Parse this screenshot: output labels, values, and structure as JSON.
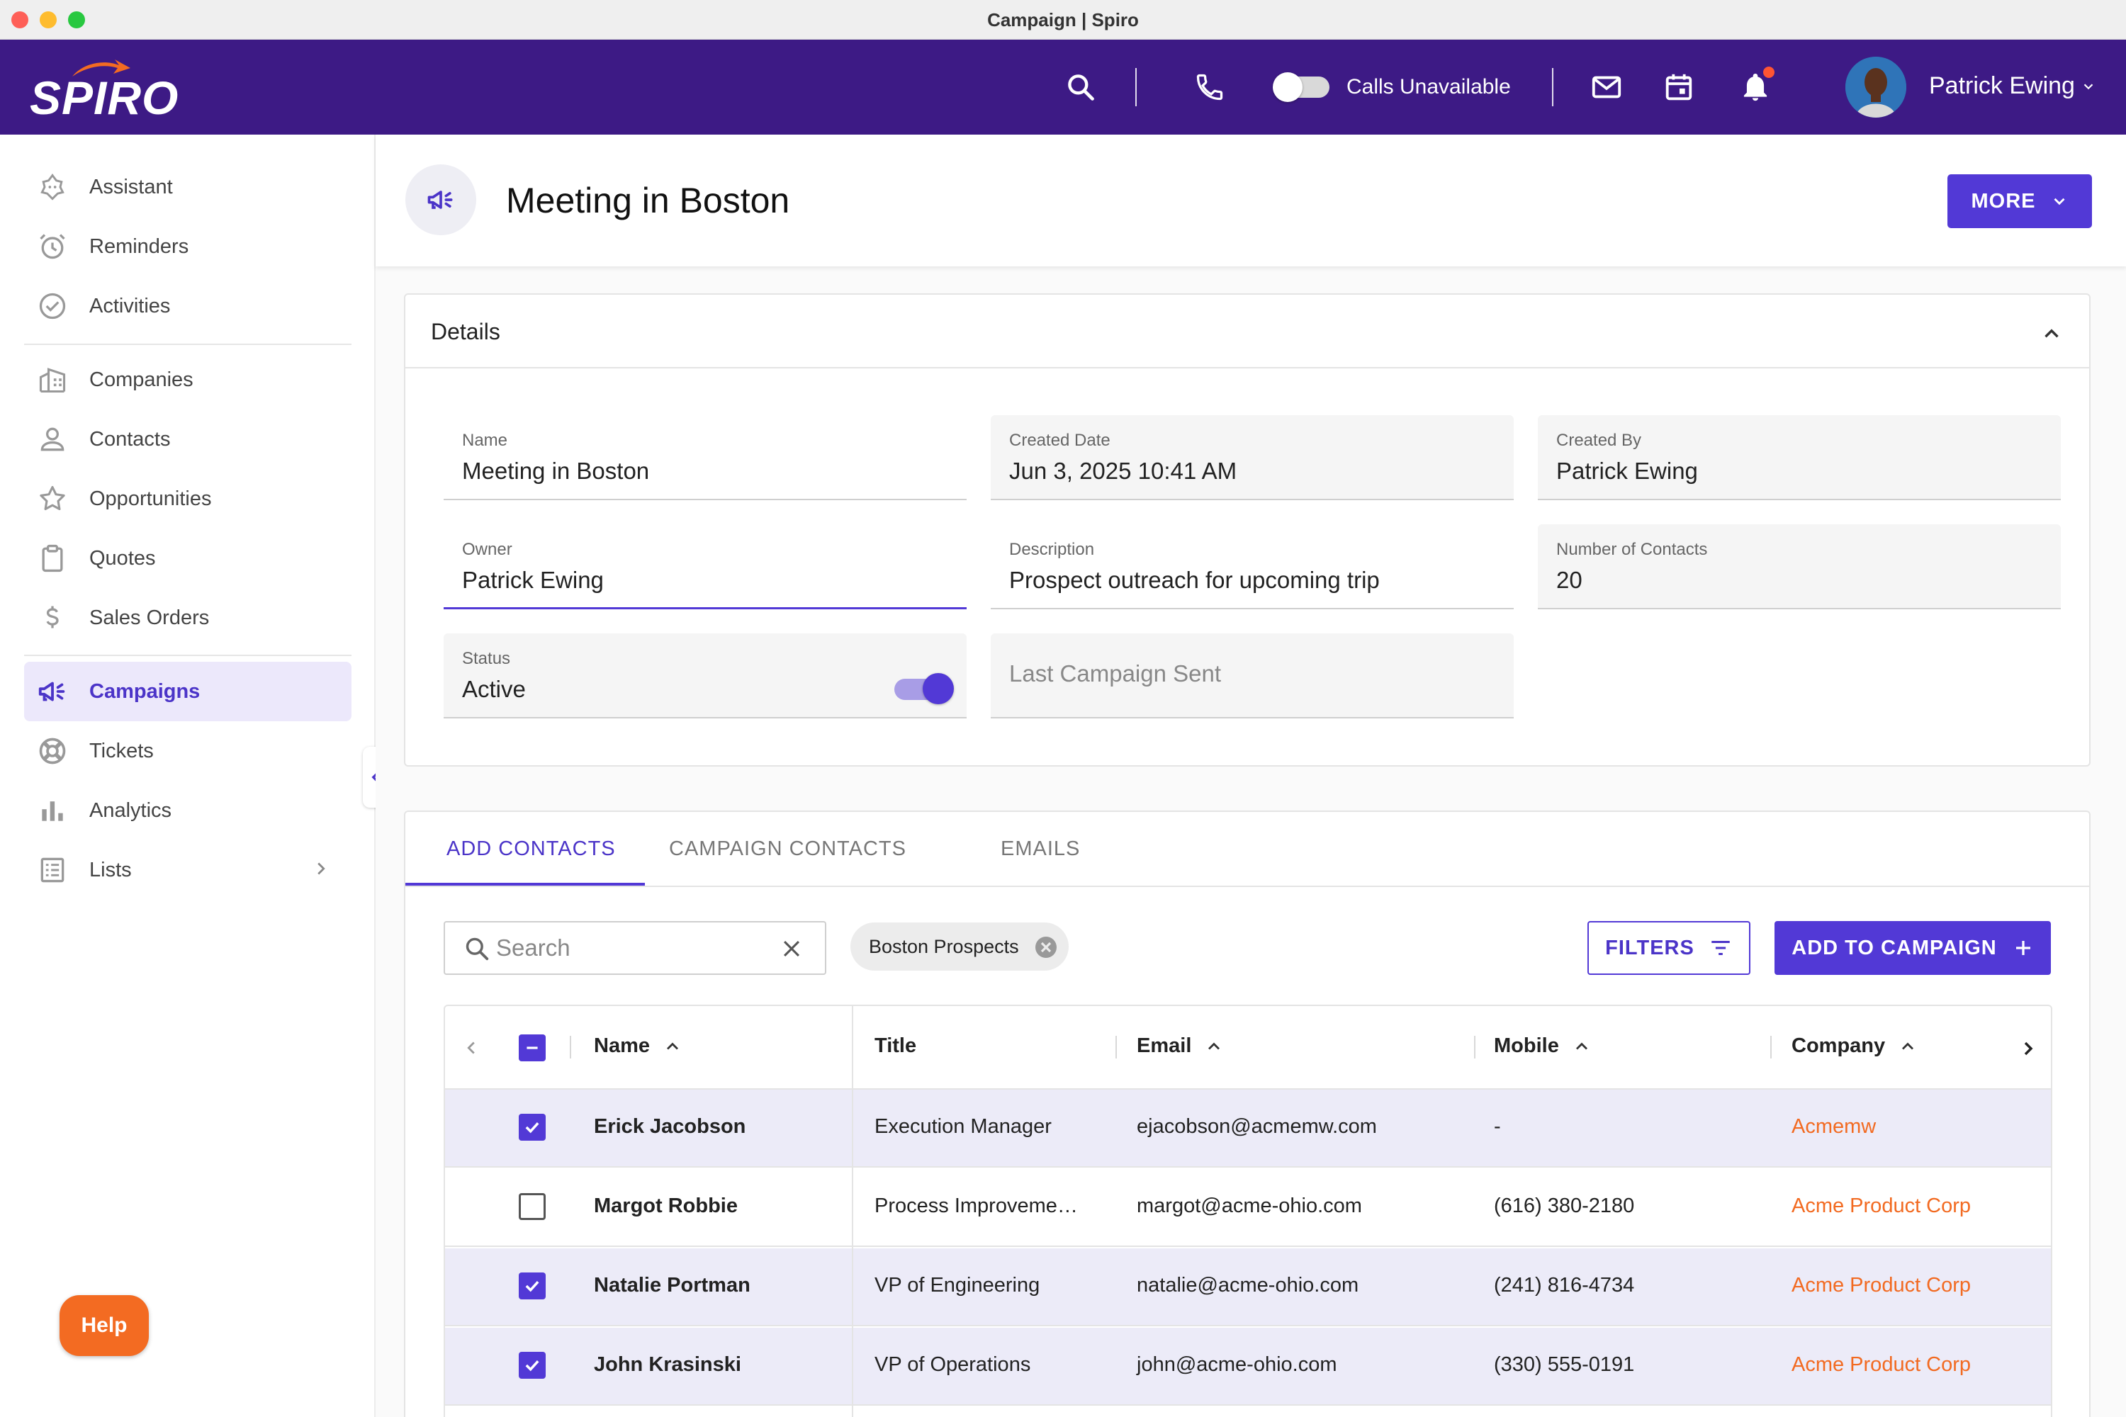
{
  "window": {
    "title": "Campaign | Spiro"
  },
  "topnav": {
    "logo_text": "SPIRO",
    "calls_label": "Calls Unavailable",
    "calls_available": false,
    "user_name": "Patrick Ewing",
    "has_notification": true,
    "icons": [
      "search-icon",
      "phone-icon",
      "mail-icon",
      "calendar-icon",
      "bell-icon"
    ],
    "brand_color": "#3d1a85"
  },
  "sidebar": {
    "items": [
      {
        "label": "Assistant",
        "icon": "assistant-icon"
      },
      {
        "label": "Reminders",
        "icon": "alarm-clock-icon"
      },
      {
        "label": "Activities",
        "icon": "check-circle-icon"
      },
      {
        "label": "Companies",
        "icon": "building-icon"
      },
      {
        "label": "Contacts",
        "icon": "person-icon"
      },
      {
        "label": "Opportunities",
        "icon": "star-icon"
      },
      {
        "label": "Quotes",
        "icon": "clipboard-icon"
      },
      {
        "label": "Sales Orders",
        "icon": "dollar-icon"
      },
      {
        "label": "Campaigns",
        "icon": "megaphone-icon",
        "active": true
      },
      {
        "label": "Tickets",
        "icon": "lifebuoy-icon"
      },
      {
        "label": "Analytics",
        "icon": "bar-chart-icon"
      },
      {
        "label": "Lists",
        "icon": "list-icon"
      }
    ],
    "help_label": "Help",
    "help_color": "#f36b22"
  },
  "header": {
    "title": "Meeting in Boston",
    "more_label": "MORE",
    "accent": "#5239d6"
  },
  "details": {
    "title": "Details",
    "fields": {
      "name": {
        "label": "Name",
        "value": "Meeting in Boston"
      },
      "created_date": {
        "label": "Created Date",
        "value": "Jun 3, 2025 10:41 AM"
      },
      "created_by": {
        "label": "Created By",
        "value": "Patrick Ewing"
      },
      "owner": {
        "label": "Owner",
        "value": "Patrick Ewing"
      },
      "description": {
        "label": "Description",
        "value": "Prospect outreach for upcoming trip"
      },
      "num_contacts": {
        "label": "Number of Contacts",
        "value": "20"
      },
      "status": {
        "label": "Status",
        "value": "Active",
        "on": true
      },
      "last_sent": {
        "placeholder": "Last Campaign Sent"
      }
    }
  },
  "contacts": {
    "tabs": [
      {
        "label": "ADD CONTACTS",
        "active": true
      },
      {
        "label": "CAMPAIGN CONTACTS"
      },
      {
        "label": "EMAILS"
      }
    ],
    "search": {
      "placeholder": "Search",
      "value": ""
    },
    "chip": "Boston Prospects",
    "filters_label": "FILTERS",
    "add_label": "ADD TO CAMPAIGN",
    "columns": [
      "Name",
      "Title",
      "Email",
      "Mobile",
      "Company"
    ],
    "rows": [
      {
        "name": "Erick Jacobson",
        "title": "Execution Manager",
        "email": "ejacobson@acmemw.com",
        "mobile": "-",
        "company": "Acmemw",
        "checked": true
      },
      {
        "name": "Margot Robbie",
        "title": "Process Improveme…",
        "email": "margot@acme-ohio.com",
        "mobile": "(616) 380-2180",
        "company": "Acme Product Corp",
        "checked": false
      },
      {
        "name": "Natalie Portman",
        "title": "VP of Engineering",
        "email": "natalie@acme-ohio.com",
        "mobile": "(241) 816-4734",
        "company": "Acme Product Corp",
        "checked": true
      },
      {
        "name": "John Krasinski",
        "title": "VP of Operations",
        "email": "john@acme-ohio.com",
        "mobile": "(330) 555-0191",
        "company": "Acme Product Corp",
        "checked": true
      }
    ],
    "company_link_color": "#f26a21"
  }
}
